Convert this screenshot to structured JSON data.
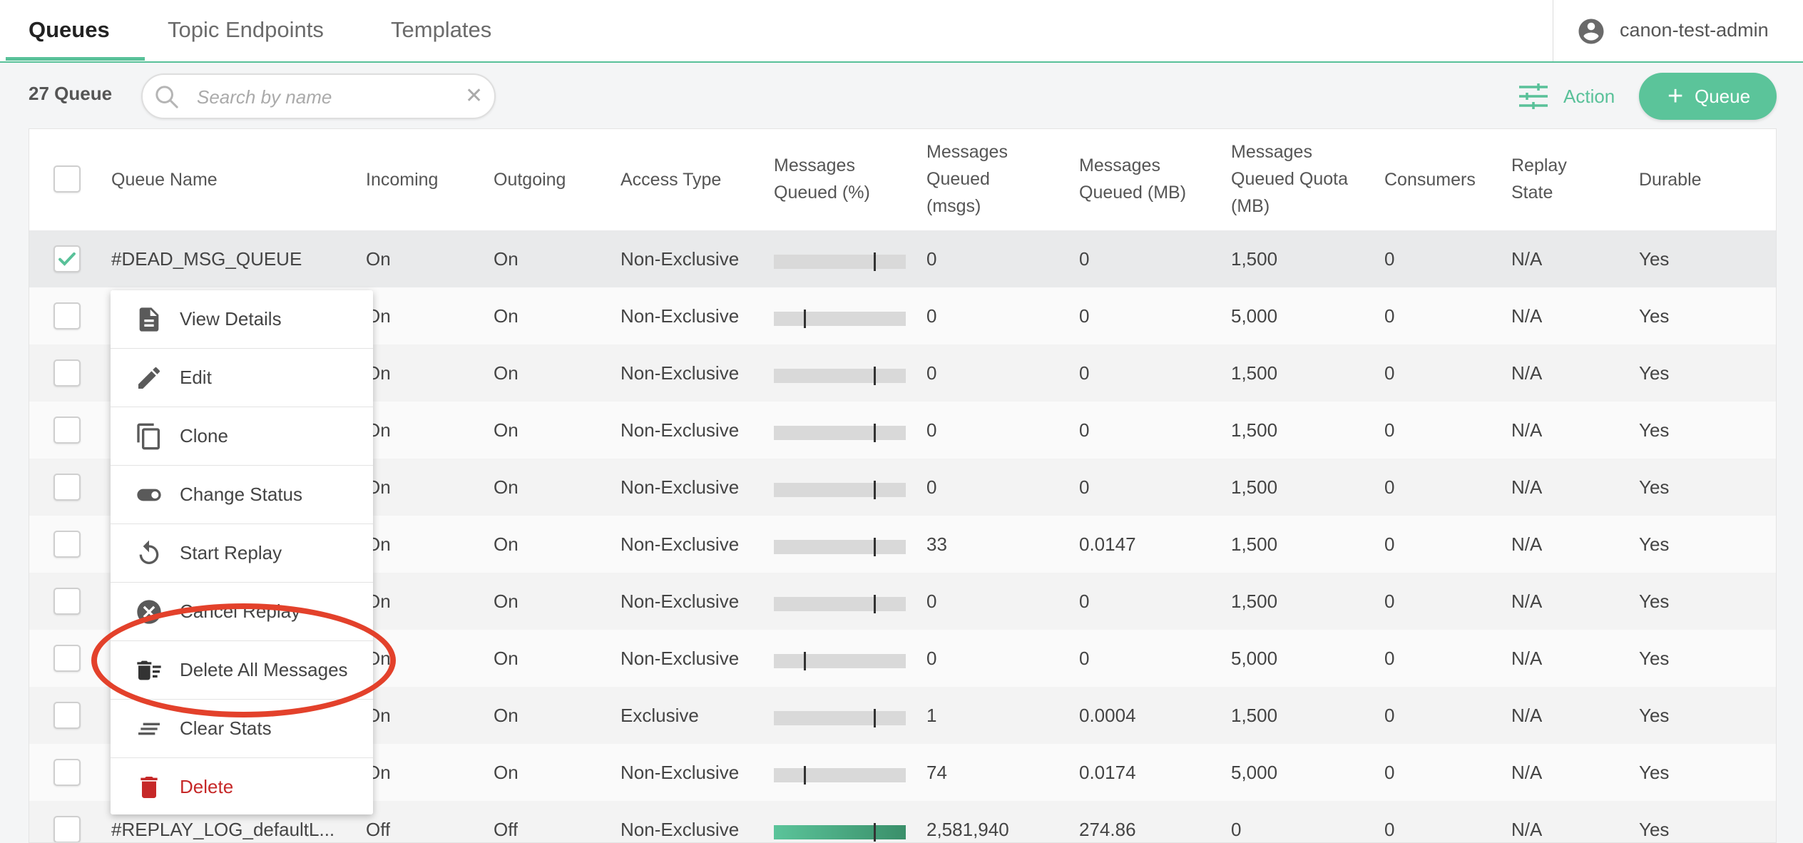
{
  "tabs": [
    {
      "label": "Queues",
      "active": true
    },
    {
      "label": "Topic Endpoints",
      "active": false
    },
    {
      "label": "Templates",
      "active": false
    }
  ],
  "user": {
    "name": "canon-test-admin",
    "icon": "account-circle-icon"
  },
  "toolbar": {
    "count_label": "27 Queue",
    "search_placeholder": "Search by name",
    "action_label": "Action",
    "add_label": "Queue"
  },
  "colors": {
    "accent": "#59c199",
    "danger": "#c62828",
    "annotation": "#e3412b"
  },
  "table": {
    "headers": {
      "name": "Queue Name",
      "incoming": "Incoming",
      "outgoing": "Outgoing",
      "access": "Access Type",
      "pct": [
        "Messages",
        "Queued (%)"
      ],
      "msgs": [
        "Messages",
        "Queued",
        "(msgs)"
      ],
      "mb": [
        "Messages",
        "Queued (MB)"
      ],
      "quota": [
        "Messages",
        "Queued Quota",
        "(MB)"
      ],
      "consumers": "Consumers",
      "replay": [
        "Replay",
        "State"
      ],
      "durable": "Durable"
    },
    "rows": [
      {
        "name": "#DEAD_MSG_QUEUE",
        "incoming": "On",
        "outgoing": "On",
        "access": "Non-Exclusive",
        "fill_pct": 0,
        "marker": "high",
        "msgs": "0",
        "mb": "0",
        "quota": "1,500",
        "consumers": "0",
        "replay": "N/A",
        "durable": "Yes",
        "checked": true
      },
      {
        "name": "",
        "incoming": "On",
        "outgoing": "On",
        "access": "Non-Exclusive",
        "fill_pct": 0,
        "marker": "low",
        "msgs": "0",
        "mb": "0",
        "quota": "5,000",
        "consumers": "0",
        "replay": "N/A",
        "durable": "Yes",
        "checked": false
      },
      {
        "name": "",
        "incoming": "On",
        "outgoing": "On",
        "access": "Non-Exclusive",
        "fill_pct": 0,
        "marker": "high",
        "msgs": "0",
        "mb": "0",
        "quota": "1,500",
        "consumers": "0",
        "replay": "N/A",
        "durable": "Yes",
        "checked": false
      },
      {
        "name": "",
        "incoming": "On",
        "outgoing": "On",
        "access": "Non-Exclusive",
        "fill_pct": 0,
        "marker": "high",
        "msgs": "0",
        "mb": "0",
        "quota": "1,500",
        "consumers": "0",
        "replay": "N/A",
        "durable": "Yes",
        "checked": false
      },
      {
        "name": "",
        "incoming": "On",
        "outgoing": "On",
        "access": "Non-Exclusive",
        "fill_pct": 0,
        "marker": "high",
        "msgs": "0",
        "mb": "0",
        "quota": "1,500",
        "consumers": "0",
        "replay": "N/A",
        "durable": "Yes",
        "checked": false
      },
      {
        "name": "",
        "incoming": "On",
        "outgoing": "On",
        "access": "Non-Exclusive",
        "fill_pct": 0,
        "marker": "high",
        "msgs": "33",
        "mb": "0.0147",
        "quota": "1,500",
        "consumers": "0",
        "replay": "N/A",
        "durable": "Yes",
        "checked": false
      },
      {
        "name": "",
        "incoming": "On",
        "outgoing": "On",
        "access": "Non-Exclusive",
        "fill_pct": 0,
        "marker": "high",
        "msgs": "0",
        "mb": "0",
        "quota": "1,500",
        "consumers": "0",
        "replay": "N/A",
        "durable": "Yes",
        "checked": false
      },
      {
        "name": "",
        "incoming": "On",
        "outgoing": "On",
        "access": "Non-Exclusive",
        "fill_pct": 0,
        "marker": "low",
        "msgs": "0",
        "mb": "0",
        "quota": "5,000",
        "consumers": "0",
        "replay": "N/A",
        "durable": "Yes",
        "checked": false
      },
      {
        "name": "",
        "incoming": "On",
        "outgoing": "On",
        "access": "Exclusive",
        "fill_pct": 0,
        "marker": "high",
        "msgs": "1",
        "mb": "0.0004",
        "quota": "1,500",
        "consumers": "0",
        "replay": "N/A",
        "durable": "Yes",
        "checked": false
      },
      {
        "name": "",
        "incoming": "On",
        "outgoing": "On",
        "access": "Non-Exclusive",
        "fill_pct": 0,
        "marker": "low",
        "msgs": "74",
        "mb": "0.0174",
        "quota": "5,000",
        "consumers": "0",
        "replay": "N/A",
        "durable": "Yes",
        "checked": false
      },
      {
        "name": "#REPLAY_LOG_defaultL...",
        "incoming": "Off",
        "outgoing": "Off",
        "access": "Non-Exclusive",
        "fill_pct": 100,
        "marker": "high",
        "msgs": "2,581,940",
        "mb": "274.86",
        "quota": "0",
        "consumers": "0",
        "replay": "N/A",
        "durable": "Yes",
        "checked": false
      }
    ]
  },
  "context_menu": {
    "items": [
      {
        "label": "View Details",
        "icon": "document-icon"
      },
      {
        "label": "Edit",
        "icon": "pencil-icon"
      },
      {
        "label": "Clone",
        "icon": "copy-icon"
      },
      {
        "label": "Change Status",
        "icon": "toggle-icon"
      },
      {
        "label": "Start Replay",
        "icon": "replay-icon"
      },
      {
        "label": "Cancel Replay",
        "icon": "cancel-circle-icon"
      },
      {
        "label": "Delete All Messages",
        "icon": "delete-sweep-icon"
      },
      {
        "label": "Clear Stats",
        "icon": "clear-all-icon"
      },
      {
        "label": "Delete",
        "icon": "trash-icon"
      }
    ]
  }
}
